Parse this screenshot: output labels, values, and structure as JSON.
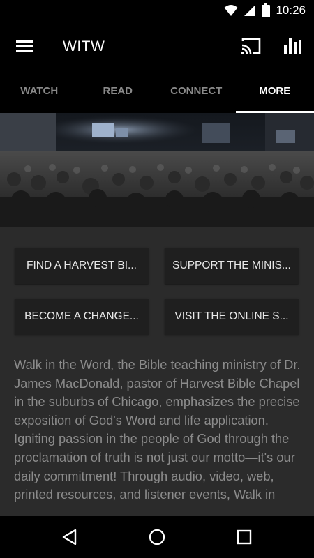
{
  "status": {
    "time": "10:26"
  },
  "app_bar": {
    "title": "WITW"
  },
  "tabs": [
    {
      "label": "WATCH"
    },
    {
      "label": "READ"
    },
    {
      "label": "CONNECT"
    },
    {
      "label": "MORE",
      "active": true
    }
  ],
  "buttons": [
    {
      "label": "FIND A HARVEST BI..."
    },
    {
      "label": "SUPPORT THE MINIS..."
    },
    {
      "label": "BECOME A CHANGE..."
    },
    {
      "label": "VISIT THE ONLINE S..."
    }
  ],
  "description": "Walk in the Word, the Bible teaching ministry of Dr. James MacDonald, pastor of Harvest Bible Chapel in the suburbs of Chicago, emphasizes the precise exposition of God's Word and life application. Igniting passion in the people of God through the proclamation of truth is not just our motto—it's our daily commitment! Through audio, video, web, printed resources, and listener events, Walk in",
  "icons": {
    "wifi": "wifi-icon",
    "signal": "signal-icon",
    "battery": "battery-icon",
    "menu": "hamburger-menu-icon",
    "cast": "cast-icon",
    "stats": "bar-chart-icon",
    "back": "back-triangle-icon",
    "home": "home-circle-icon",
    "recents": "recents-square-icon"
  },
  "colors": {
    "background": "#000000",
    "content": "#2b2b2b",
    "button": "#1f1f1f",
    "text_muted": "#8b8b8b",
    "tab_inactive": "#8a8a8a"
  }
}
